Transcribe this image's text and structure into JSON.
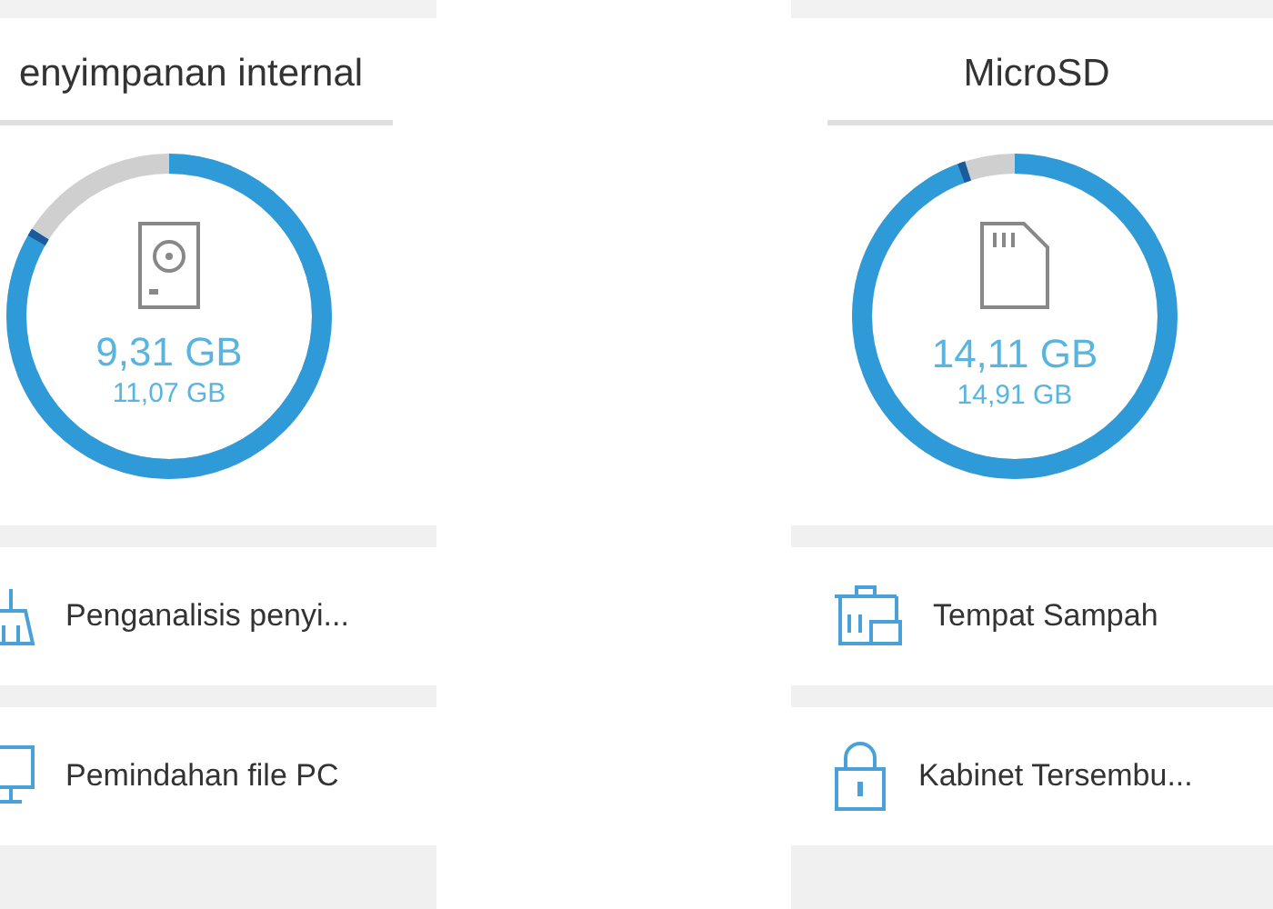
{
  "panels": [
    {
      "title": "enyimpanan internal",
      "kind": "internal",
      "used": "9,31 GB",
      "total": "11,07 GB",
      "items": [
        {
          "label": "Penganalisis penyi...",
          "kind": "analyzer"
        },
        {
          "label": "Pemindahan file PC",
          "kind": "transfer"
        }
      ]
    },
    {
      "title": "MicroSD",
      "kind": "sdcard",
      "used": "14,11 GB",
      "total": "14,91 GB",
      "items": [
        {
          "label": "Tempat Sampah",
          "kind": "trash"
        },
        {
          "label": "Kabinet Tersembu...",
          "kind": "lock"
        }
      ]
    }
  ]
}
